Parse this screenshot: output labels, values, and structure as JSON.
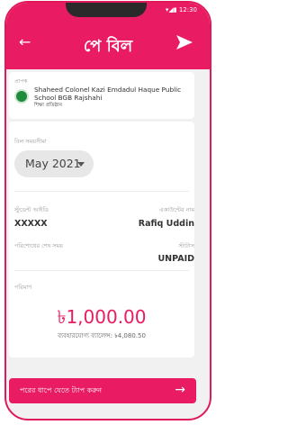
{
  "status_bar": {
    "time": "12:30",
    "icons": "▾◢▮"
  },
  "appbar": {
    "title": "পে বিল",
    "back_icon": "back-arrow-icon",
    "send_icon": "send-icon"
  },
  "school": {
    "label": "প্রাপক",
    "name": "Shaheed Colonel Kazi Emdadul Haque Public School BGB Rajshahi",
    "type": "শিক্ষা প্রতিষ্ঠান"
  },
  "bill_period": {
    "label": "বিল সময়সীমা",
    "selected": "May 2021"
  },
  "student_id": {
    "label": "স্টুডেন্ট আইডি",
    "value": "XXXXX"
  },
  "account_name": {
    "label": "একাউন্টের নাম",
    "value": "Rafiq Uddin"
  },
  "payment_deadline": {
    "label": "পরিশোধের শেষ সময়",
    "value": ""
  },
  "status": {
    "label": "স্টাটাস",
    "value": "UNPAID"
  },
  "amount": {
    "label": "পরিমাণ",
    "value": "৳1,000.00"
  },
  "available_balance": "ব্যবহারযোগ্য ব্যালেন্স: ৳4,080.50",
  "cta": {
    "label": "পরের ধাপে যেতে ট্যাপ করুন",
    "arrow": "→"
  },
  "colors": {
    "accent": "#e91b63",
    "background": "#f1f1f1"
  }
}
